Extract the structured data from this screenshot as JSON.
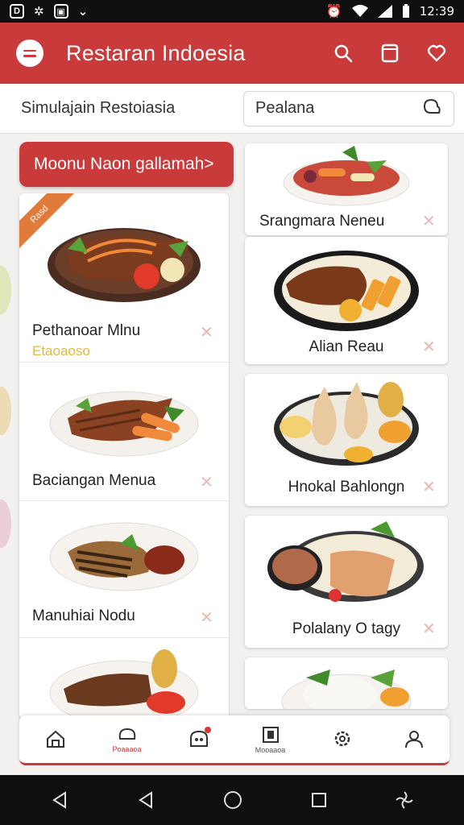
{
  "status_bar": {
    "left_icons": [
      "dropbox-icon",
      "settings-glyph-icon",
      "gallery-icon",
      "check-icon"
    ],
    "time": "12:39"
  },
  "app_bar": {
    "title": "Restaran Indoesia",
    "actions": [
      "search-icon",
      "bookmark-icon",
      "share-icon"
    ]
  },
  "search_strip": {
    "label": "Simulajain Restoiasia",
    "search_value": "Pealana"
  },
  "left_column": {
    "promo_button": "Moonu Naon gallamah>",
    "ribbon_text": "Rasd",
    "items": [
      {
        "title": "Pethanoar Mlnu",
        "subtitle": "Etaoaoso"
      },
      {
        "title": "Baciangan Menua"
      },
      {
        "title": "Manuhiai Nodu"
      },
      {
        "title": ""
      }
    ]
  },
  "right_column": {
    "items": [
      {
        "title": "Srangmara Neneu"
      },
      {
        "title": "Alian Reau"
      },
      {
        "title": "Hnokal Bahlongn"
      },
      {
        "title": "Polalany O tagy"
      },
      {
        "title": ""
      }
    ]
  },
  "bottom_nav": {
    "items": [
      {
        "label": "",
        "icon": "home-icon"
      },
      {
        "label": "Poaaaoa",
        "icon": "chat-icon"
      },
      {
        "label": "",
        "icon": "cart-icon"
      },
      {
        "label": "Mooaaoa",
        "icon": "menu-book-icon"
      },
      {
        "label": "",
        "icon": "settings-icon"
      },
      {
        "label": "",
        "icon": "profile-icon"
      }
    ]
  },
  "colors": {
    "brand_red": "#c93a3a",
    "ribbon_orange": "#e07b3c",
    "subtitle_yellow": "#e0b840"
  }
}
